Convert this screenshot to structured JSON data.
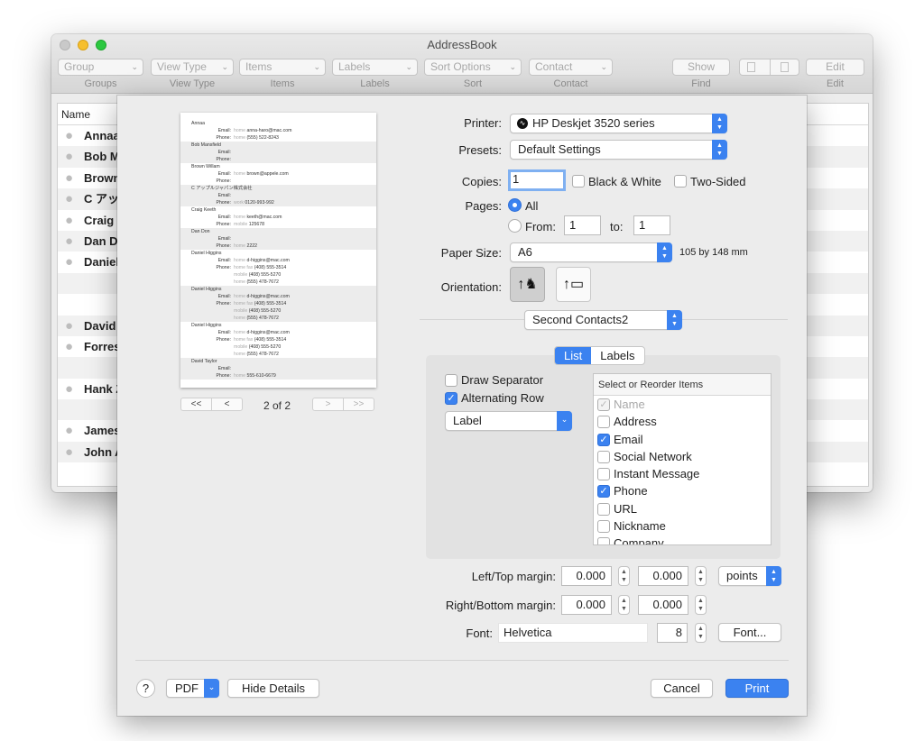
{
  "window": {
    "title": "AddressBook",
    "toolbar": [
      {
        "value": "Group",
        "label": "Groups"
      },
      {
        "value": "View Type",
        "label": "View Type"
      },
      {
        "value": "Items",
        "label": "Items"
      },
      {
        "value": "Labels",
        "label": "Labels"
      },
      {
        "value": "Sort Options",
        "label": "Sort"
      },
      {
        "value": "Contact",
        "label": "Contact"
      },
      {
        "value": "Show",
        "label": "Find"
      },
      {
        "value": "",
        "label": ""
      },
      {
        "value": "Edit",
        "label": "Edit"
      }
    ],
    "list_header": "Name",
    "contacts": [
      "Annaa",
      "Bob M",
      "Brown",
      "C アッ",
      "Craig",
      "Dan Do",
      "Daniel",
      "",
      "",
      "David",
      "Forres",
      "",
      "Hank Z",
      "",
      "James",
      "John A"
    ]
  },
  "print": {
    "printer_label": "Printer:",
    "printer": "HP Deskjet 3520 series",
    "presets_label": "Presets:",
    "presets": "Default Settings",
    "copies_label": "Copies:",
    "copies": "1",
    "bw_label": "Black & White",
    "twosided_label": "Two-Sided",
    "pages_label": "Pages:",
    "pages_all": "All",
    "from_label": "From:",
    "from": "1",
    "to_label": "to:",
    "to": "1",
    "paper_label": "Paper Size:",
    "paper": "A6",
    "paper_dims": "105 by 148 mm",
    "orientation_label": "Orientation:",
    "section": "Second Contacts2",
    "tabs": [
      "List",
      "Labels"
    ],
    "draw_separator": "Draw Separator",
    "alternating_row": "Alternating Row",
    "label_select": "Label",
    "items_head": "Select or Reorder Items",
    "items": [
      {
        "label": "Name",
        "checked": true,
        "disabled": true
      },
      {
        "label": "Address",
        "checked": false
      },
      {
        "label": "Email",
        "checked": true
      },
      {
        "label": "Social Network",
        "checked": false
      },
      {
        "label": "Instant Message",
        "checked": false
      },
      {
        "label": "Phone",
        "checked": true
      },
      {
        "label": "URL",
        "checked": false
      },
      {
        "label": "Nickname",
        "checked": false
      },
      {
        "label": "Company",
        "checked": false
      }
    ],
    "lt_margin_label": "Left/Top margin:",
    "left_margin": "0.000",
    "top_margin": "0.000",
    "units": "points",
    "rb_margin_label": "Right/Bottom margin:",
    "right_margin": "0.000",
    "bottom_margin": "0.000",
    "font_label": "Font:",
    "font": "Helvetica",
    "font_size": "8",
    "font_button": "Font...",
    "page_indicator": "2 of 2",
    "pager": {
      "first": "<<",
      "prev": "<",
      "next": ">",
      "last": ">>"
    },
    "help": "?",
    "pdf": "PDF",
    "hide_details": "Hide Details",
    "cancel": "Cancel",
    "print": "Print"
  },
  "preview_entries": [
    {
      "name": "Annaa",
      "lines": [
        [
          "Email:",
          "home",
          "anna-haro@mac.com"
        ],
        [
          "Phone:",
          "home",
          "(555) 522-8243"
        ]
      ]
    },
    {
      "name": "Bob Mansfield",
      "lines": [
        [
          "Email:",
          "",
          ""
        ],
        [
          "Phone:",
          "",
          ""
        ]
      ]
    },
    {
      "name": "Brown Willam",
      "lines": [
        [
          "Email:",
          "home",
          "brown@appele.com"
        ],
        [
          "Phone:",
          "",
          ""
        ]
      ]
    },
    {
      "name": "C アップルジャパン株式会社",
      "lines": [
        [
          "Email:",
          "",
          ""
        ],
        [
          "Phone:",
          "work",
          "0120-993-992"
        ]
      ]
    },
    {
      "name": "Craig Keeth",
      "lines": [
        [
          "Email:",
          "home",
          "keeth@mac.com"
        ],
        [
          "Phone:",
          "mobile",
          "125678"
        ]
      ]
    },
    {
      "name": "Dan Don",
      "lines": [
        [
          "Email:",
          "",
          ""
        ],
        [
          "Phone:",
          "home",
          "2222"
        ]
      ]
    },
    {
      "name": "Daniel Higgins",
      "lines": [
        [
          "Email:",
          "home",
          "d-higgins@mac.com"
        ],
        [
          "Phone:",
          "home fax",
          "(408) 555-3514"
        ],
        [
          "",
          "mobile",
          "(408) 555-5270"
        ],
        [
          "",
          "home",
          "(555) 478-7672"
        ]
      ]
    },
    {
      "name": "Daniel Higgins",
      "lines": [
        [
          "Email:",
          "home",
          "d-higgins@mac.com"
        ],
        [
          "Phone:",
          "home fax",
          "(408) 555-3514"
        ],
        [
          "",
          "mobile",
          "(408) 555-5270"
        ],
        [
          "",
          "home",
          "(555) 478-7672"
        ]
      ]
    },
    {
      "name": "Daniel Higgins",
      "lines": [
        [
          "Email:",
          "home",
          "d-higgins@mac.com"
        ],
        [
          "Phone:",
          "home fax",
          "(408) 555-3514"
        ],
        [
          "",
          "mobile",
          "(408) 555-5270"
        ],
        [
          "",
          "home",
          "(555) 478-7672"
        ]
      ]
    },
    {
      "name": "David Taylor",
      "lines": [
        [
          "Email:",
          "",
          ""
        ],
        [
          "Phone:",
          "home",
          "555-610-6679"
        ]
      ]
    }
  ]
}
